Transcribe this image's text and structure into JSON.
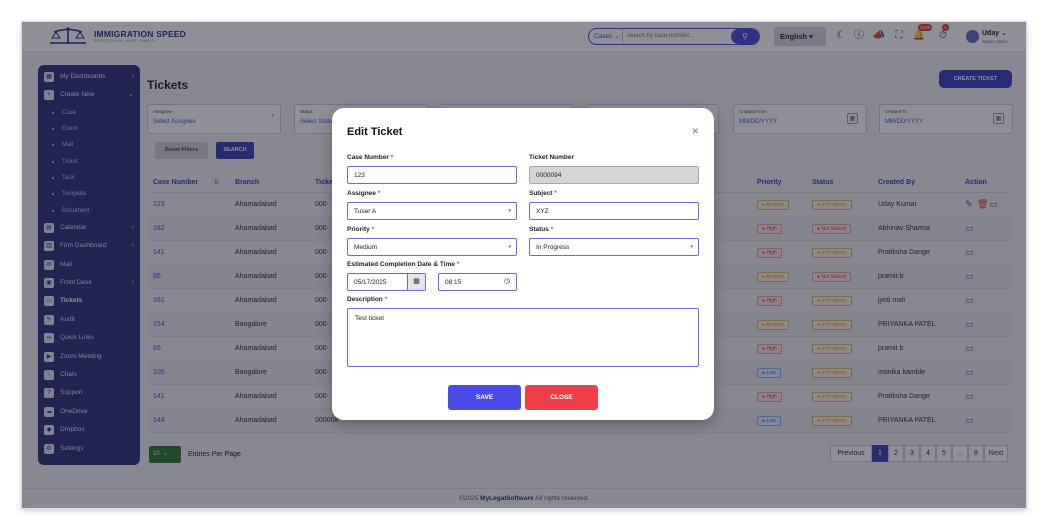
{
  "app": {
    "logo_text": "IMMIGRATION SPEED",
    "logo_sub": "PROCESSING MADE SIMPLE",
    "logo_icon": "scales-icon"
  },
  "header": {
    "search_scope": "Cases",
    "search_placeholder": "search by case number...",
    "language": "English",
    "notification_count": "2339",
    "alert_count": "1",
    "user_name": "Uday",
    "user_role": "Super Admin"
  },
  "sidebar": {
    "items": [
      {
        "label": "My Dashboards",
        "icon": "dashboard-icon",
        "chev": "›"
      },
      {
        "label": "Create New",
        "icon": "plus-box-icon",
        "chev": "⌄"
      },
      {
        "label": "Case",
        "sub": true
      },
      {
        "label": "Event",
        "sub": true
      },
      {
        "label": "Mail",
        "sub": true
      },
      {
        "label": "Ticket",
        "sub": true
      },
      {
        "label": "Task",
        "sub": true
      },
      {
        "label": "Template",
        "sub": true
      },
      {
        "label": "Document",
        "sub": true
      },
      {
        "label": "Calendar",
        "icon": "calendar-icon",
        "chev": "›"
      },
      {
        "label": "Firm Dashboard",
        "icon": "building-icon",
        "chev": "›"
      },
      {
        "label": "Mail",
        "icon": "mail-icon",
        "chev": ""
      },
      {
        "label": "Front Desk",
        "icon": "desk-icon",
        "chev": "›"
      },
      {
        "label": "Tickets",
        "icon": "ticket-icon",
        "chev": "",
        "active": true
      },
      {
        "label": "Audit",
        "icon": "audit-icon",
        "chev": ""
      },
      {
        "label": "Quick Links",
        "icon": "link-icon",
        "chev": ""
      },
      {
        "label": "Zoom Meeting",
        "icon": "video-icon",
        "chev": ""
      },
      {
        "label": "Chats",
        "icon": "chat-icon",
        "chev": ""
      },
      {
        "label": "Support",
        "icon": "support-icon",
        "chev": ""
      },
      {
        "label": "OneDrive",
        "icon": "cloud-icon",
        "chev": ""
      },
      {
        "label": "Dropbox",
        "icon": "dropbox-icon",
        "chev": ""
      },
      {
        "label": "Settings",
        "icon": "gear-icon",
        "chev": ""
      }
    ]
  },
  "page": {
    "title": "Tickets",
    "create_label": "CREATE TICKET"
  },
  "filters": {
    "assignee_label": "Assignee",
    "assignee_value": "Select Assignee",
    "status_label": "Status",
    "status_value": "Select Status",
    "created_from_label": "Created From",
    "created_from_value": "MM/DD/YYYY",
    "created_to_label": "Created To",
    "created_to_value": "MM/DD/YYYY",
    "reset_label": "Reset Filters",
    "search_label": "SEARCH"
  },
  "table": {
    "headers": {
      "case_number": "Case Number",
      "branch": "Branch",
      "ticket": "Ticke",
      "priority": "Priority",
      "status": "Status",
      "created_by": "Created By",
      "action": "Action"
    },
    "rows": [
      {
        "case": "123",
        "branch": "Ahamadabad",
        "ticket": "000",
        "priority": "Medium",
        "pclass": "medium",
        "status": "In Progress",
        "sclass": "prog",
        "created_by": "Uday Kumar",
        "full_actions": true
      },
      {
        "case": "182",
        "branch": "Ahamadabad",
        "ticket": "000",
        "priority": "High",
        "pclass": "high",
        "status": "Not Solved",
        "sclass": "notsolved",
        "created_by": "Abhinav Sharma"
      },
      {
        "case": "141",
        "branch": "Ahamadabad",
        "ticket": "000",
        "priority": "High",
        "pclass": "high",
        "status": "In Progress",
        "sclass": "prog",
        "created_by": "Pratiksha Dange"
      },
      {
        "case": "86",
        "branch": "Ahamadabad",
        "ticket": "000",
        "priority": "Medium",
        "pclass": "medium",
        "status": "Not Solved",
        "sclass": "notsolved",
        "created_by": "pramit b"
      },
      {
        "case": "161",
        "branch": "Ahamadabad",
        "ticket": "000",
        "priority": "High",
        "pclass": "high",
        "status": "In Progress",
        "sclass": "prog",
        "created_by": "jyoti mali"
      },
      {
        "case": "154",
        "branch": "Bangalore",
        "ticket": "000",
        "priority": "Medium",
        "pclass": "medium",
        "status": "In Progress",
        "sclass": "prog",
        "created_by": "PRIYANKA PATEL"
      },
      {
        "case": "86",
        "branch": "Ahamadabad",
        "ticket": "000",
        "priority": "High",
        "pclass": "high",
        "status": "In Progress",
        "sclass": "prog",
        "created_by": "pramit b"
      },
      {
        "case": "105",
        "branch": "Bangalore",
        "ticket": "000",
        "priority": "Low",
        "pclass": "low",
        "status": "In Progress",
        "sclass": "prog",
        "created_by": "monika kamble"
      },
      {
        "case": "141",
        "branch": "Ahamadabad",
        "ticket": "000",
        "priority": "High",
        "pclass": "high",
        "status": "In Progress",
        "sclass": "prog",
        "created_by": "Pratiksha Dange"
      },
      {
        "case": "144",
        "branch": "Ahamadabad",
        "ticket": "000008",
        "priority": "Low",
        "pclass": "low",
        "status": "In Progress",
        "sclass": "prog",
        "created_by": "PRIYANKA PATEL"
      }
    ]
  },
  "pagination": {
    "entries_value": "10",
    "entries_label": "Entries Per Page",
    "prev_label": "Previous",
    "pages": [
      "1",
      "2",
      "3",
      "4",
      "5",
      "...",
      "8"
    ],
    "next_label": "Next"
  },
  "footer": {
    "prefix": "©2025",
    "brand": "MyLegalSoftware",
    "suffix": "All rights reserved."
  },
  "modal": {
    "title": "Edit Ticket",
    "case_number_label": "Case Number",
    "case_number_value": "123",
    "ticket_number_label": "Ticket Number",
    "ticket_number_value": "0000094",
    "assignee_label": "Assignee",
    "assignee_value": "Tuser A",
    "subject_label": "Subject",
    "subject_value": "XYZ",
    "priority_label": "Priority",
    "priority_value": "Medium",
    "status_label": "Status",
    "status_value": "In Progress",
    "eta_label": "Estimated Completion Date & Time",
    "date_value": "05/17/2025",
    "time_value": "08:15",
    "description_label": "Description",
    "description_value": "Test ticket",
    "save_label": "SAVE",
    "close_label": "CLOSE"
  }
}
